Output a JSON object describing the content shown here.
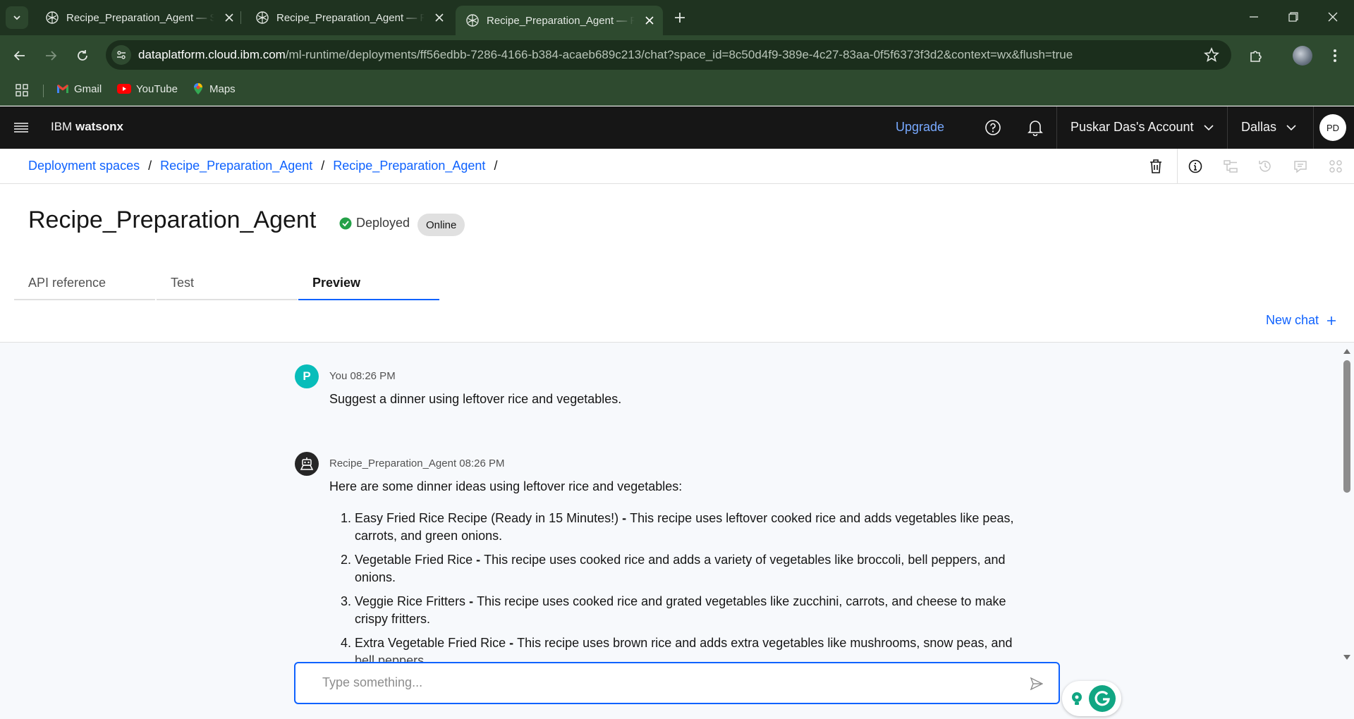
{
  "browser": {
    "tabs": [
      {
        "title": "Recipe_Preparation_Agent — Sp",
        "active": false
      },
      {
        "title": "Recipe_Preparation_Agent — Re",
        "active": false
      },
      {
        "title": "Recipe_Preparation_Agent — Re",
        "active": true
      }
    ],
    "url": {
      "host": "dataplatform.cloud.ibm.com",
      "path": "/ml-runtime/deployments/ff56edbb-7286-4166-b384-acaeb689c213/chat?space_id=8c50d4f9-389e-4c27-83aa-0f5f6373f3d2&context=wx&flush=true"
    },
    "bookmarks": [
      {
        "label": "Gmail",
        "icon": "gmail-icon"
      },
      {
        "label": "YouTube",
        "icon": "youtube-icon"
      },
      {
        "label": "Maps",
        "icon": "maps-icon"
      }
    ]
  },
  "header": {
    "brand_prefix": "IBM",
    "brand_product": "watsonx",
    "upgrade": "Upgrade",
    "account": "Puskar Das's Account",
    "region": "Dallas",
    "avatar_initials": "PD"
  },
  "breadcrumb": {
    "items": [
      "Deployment spaces",
      "Recipe_Preparation_Agent",
      "Recipe_Preparation_Agent"
    ],
    "separator": "/"
  },
  "page": {
    "title": "Recipe_Preparation_Agent",
    "status": "Deployed",
    "badge": "Online",
    "tabs": [
      "API reference",
      "Test",
      "Preview"
    ],
    "selected_tab": "Preview",
    "new_chat": "New chat"
  },
  "chat": {
    "user": {
      "avatar": "P",
      "meta": "You 08:26 PM",
      "text": "Suggest a dinner using leftover rice and vegetables."
    },
    "agent": {
      "meta": "Recipe_Preparation_Agent 08:26 PM",
      "intro": "Here are some dinner ideas using leftover rice and vegetables:",
      "items": [
        {
          "num": "1.",
          "title": "Easy Fried Rice Recipe (Ready in 15 Minutes!)",
          "sep": " - ",
          "text": "This recipe uses leftover cooked rice and adds vegetables like peas, carrots, and green onions."
        },
        {
          "num": "2.",
          "title": "Vegetable Fried Rice",
          "sep": " - ",
          "text": "This recipe uses cooked rice and adds a variety of vegetables like broccoli, bell peppers, and onions."
        },
        {
          "num": "3.",
          "title": "Veggie Rice Fritters",
          "sep": " - ",
          "text": "This recipe uses cooked rice and grated vegetables like zucchini, carrots, and cheese to make crispy fritters."
        },
        {
          "num": "4.",
          "title": "Extra Vegetable Fried Rice",
          "sep": " - ",
          "text": "This recipe uses brown rice and adds extra vegetables like mushrooms, snow peas, and bell peppers."
        }
      ]
    },
    "composer_placeholder": "Type something..."
  },
  "colors": {
    "ibm_blue": "#0f62fe",
    "user_avatar": "#08bdba",
    "deployed_green": "#24a148",
    "browser_frame": "#2e4a2f"
  }
}
